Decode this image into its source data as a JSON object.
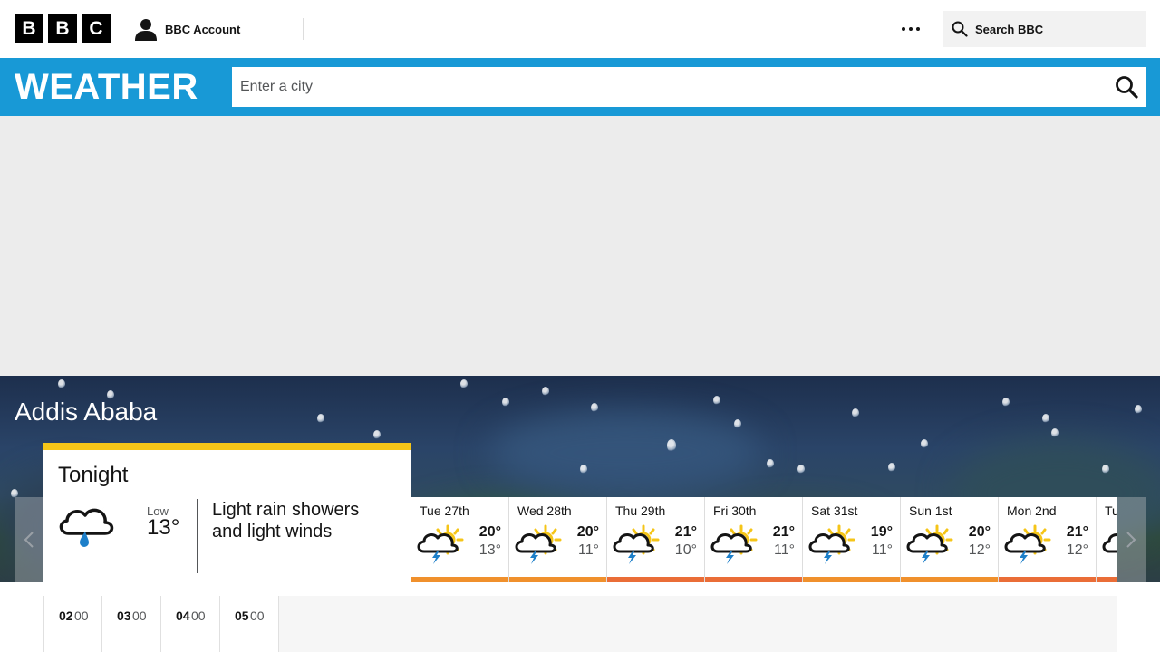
{
  "header": {
    "logo": [
      "B",
      "B",
      "C"
    ],
    "account_label": "BBC Account",
    "more_icon": "ellipsis-icon",
    "search_label": "Search BBC"
  },
  "weather_bar": {
    "title": "WEATHER",
    "search_placeholder": "Enter a city"
  },
  "location": {
    "name": "Addis Ababa"
  },
  "tonight": {
    "title": "Tonight",
    "low_label": "Low",
    "low_temp": "13°",
    "description": "Light rain showers and light winds",
    "icon": "light-rain-shower-night-icon"
  },
  "days": [
    {
      "label": "Tue 27th",
      "high": "20°",
      "low": "13°",
      "icon": "thundery-shower-icon",
      "bar_color": "#f0902c"
    },
    {
      "label": "Wed 28th",
      "high": "20°",
      "low": "11°",
      "icon": "thundery-shower-icon",
      "bar_color": "#f0902c"
    },
    {
      "label": "Thu 29th",
      "high": "21°",
      "low": "10°",
      "icon": "thundery-shower-icon",
      "bar_color": "#ea6d37"
    },
    {
      "label": "Fri 30th",
      "high": "21°",
      "low": "11°",
      "icon": "thundery-shower-icon",
      "bar_color": "#ea6d37"
    },
    {
      "label": "Sat 31st",
      "high": "19°",
      "low": "11°",
      "icon": "thundery-shower-icon",
      "bar_color": "#f0902c"
    },
    {
      "label": "Sun 1st",
      "high": "20°",
      "low": "12°",
      "icon": "thundery-shower-icon",
      "bar_color": "#f0902c"
    },
    {
      "label": "Mon 2nd",
      "high": "21°",
      "low": "12°",
      "icon": "thundery-shower-icon",
      "bar_color": "#ea6d37"
    },
    {
      "label": "Tu",
      "high": "",
      "low": "",
      "icon": "thundery-shower-icon",
      "bar_color": "#ea6d37"
    }
  ],
  "hours": [
    {
      "h": "02",
      "m": "00"
    },
    {
      "h": "03",
      "m": "00"
    },
    {
      "h": "04",
      "m": "00"
    },
    {
      "h": "05",
      "m": "00"
    }
  ]
}
